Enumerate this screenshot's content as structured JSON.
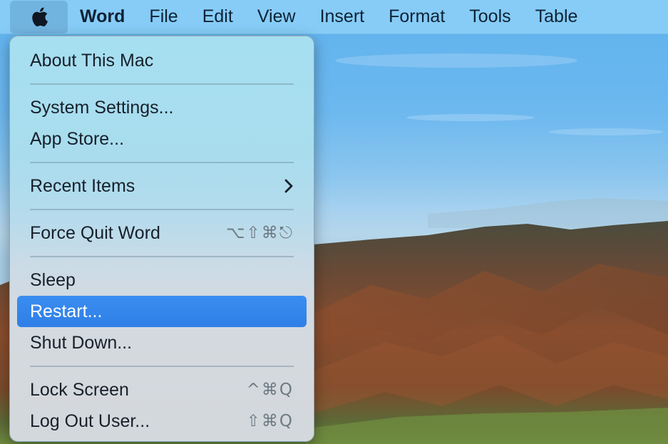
{
  "menubar": {
    "apple_icon": "apple-logo-icon",
    "items": [
      {
        "label": "Word",
        "bold": true
      },
      {
        "label": "File"
      },
      {
        "label": "Edit"
      },
      {
        "label": "View"
      },
      {
        "label": "Insert"
      },
      {
        "label": "Format"
      },
      {
        "label": "Tools"
      },
      {
        "label": "Table"
      }
    ]
  },
  "apple_menu": {
    "about": {
      "label": "About This Mac"
    },
    "system_settings": {
      "label": "System Settings..."
    },
    "app_store": {
      "label": "App Store..."
    },
    "recent_items": {
      "label": "Recent Items",
      "submenu_icon": "chevron-right-icon"
    },
    "force_quit": {
      "label": "Force Quit Word",
      "shortcut": "⌥⇧⌘⎋"
    },
    "sleep": {
      "label": "Sleep"
    },
    "restart": {
      "label": "Restart...",
      "highlighted": true
    },
    "shut_down": {
      "label": "Shut Down..."
    },
    "lock_screen": {
      "label": "Lock Screen",
      "shortcut": "^⌘Q"
    },
    "log_out": {
      "label": "Log Out User...",
      "shortcut": "⇧⌘Q"
    }
  },
  "colors": {
    "menubar_bg": "#86ccf6",
    "highlight": "#3a8df0",
    "menu_text": "#17202a",
    "shortcut_text": "#6d7a82"
  },
  "wallpaper": {
    "description": "mountain landscape with blue sky"
  }
}
